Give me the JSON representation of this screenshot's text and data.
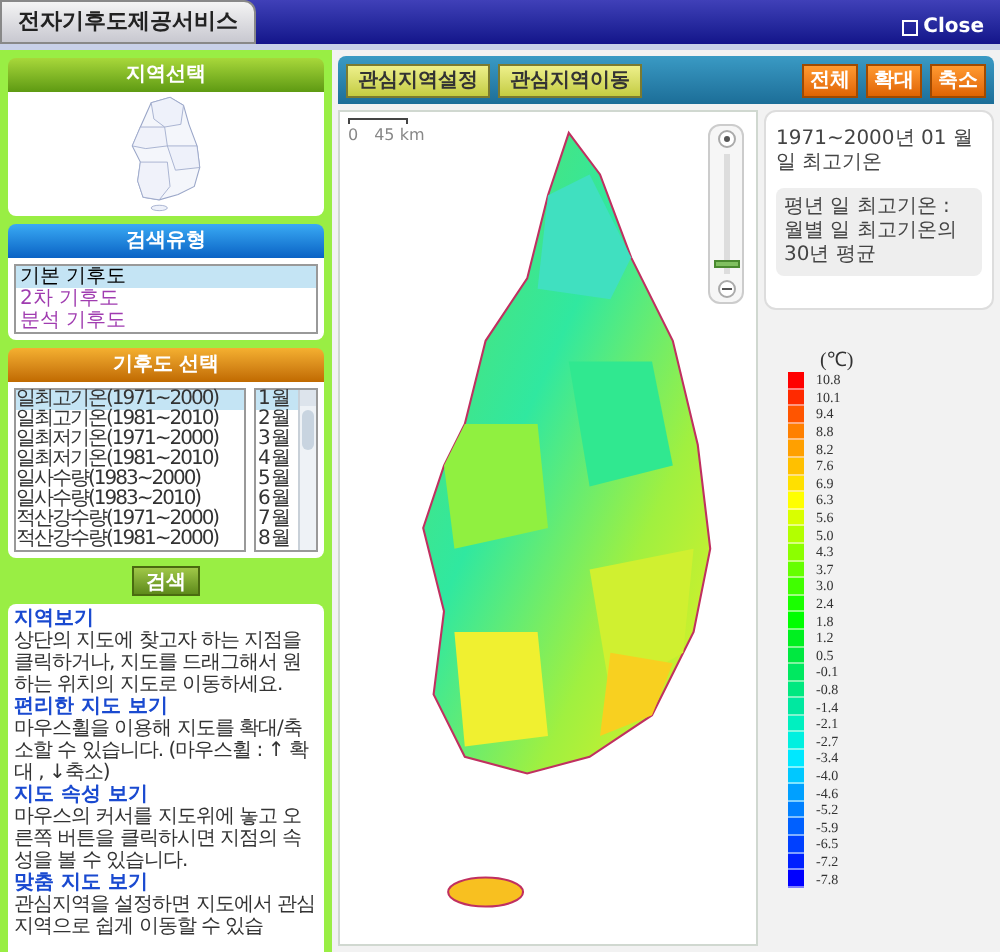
{
  "window": {
    "title": "전자기후도제공서비스",
    "close": "Close"
  },
  "region_select": {
    "title": "지역선택"
  },
  "search_type": {
    "title": "검색유형",
    "items": [
      {
        "label": "기본 기후도",
        "selected": true
      },
      {
        "label": "2차 기후도",
        "selected": false
      },
      {
        "label": "분석 기후도",
        "selected": false
      }
    ]
  },
  "map_select": {
    "title": "기후도 선택",
    "maps": [
      {
        "label": "일최고기온(1971~2000)",
        "selected": true
      },
      {
        "label": "일최고기온(1981~2010)",
        "selected": false
      },
      {
        "label": "일최저기온(1971~2000)",
        "selected": false
      },
      {
        "label": "일최저기온(1981~2010)",
        "selected": false
      },
      {
        "label": "일사수량(1983~2000)",
        "selected": false
      },
      {
        "label": "일사수량(1983~2010)",
        "selected": false
      },
      {
        "label": "적산강수량(1971~2000)",
        "selected": false
      },
      {
        "label": "적산강수량(1981~2000)",
        "selected": false
      }
    ],
    "months": [
      {
        "label": "1월",
        "selected": true
      },
      {
        "label": "2월",
        "selected": false
      },
      {
        "label": "3월",
        "selected": false
      },
      {
        "label": "4월",
        "selected": false
      },
      {
        "label": "5월",
        "selected": false
      },
      {
        "label": "6월",
        "selected": false
      },
      {
        "label": "7월",
        "selected": false
      },
      {
        "label": "8월",
        "selected": false
      }
    ],
    "search_button": "검색"
  },
  "help": [
    {
      "heading": "지역보기",
      "text": "상단의 지도에 찾고자 하는 지점을 클릭하거나, 지도를 드래그해서 원하는 위치의 지도로 이동하세요."
    },
    {
      "heading": "편리한 지도 보기",
      "text": "마우스휠을 이용해 지도를 확대/축소할 수 있습니다. (마우스휠 : ↑ 확대 , ↓축소)"
    },
    {
      "heading": "지도 속성 보기",
      "text": "마우스의 커서를 지도위에 놓고 오른쪽 버튼을 클릭하시면 지점의 속성을 볼 수 있습니다."
    },
    {
      "heading": "맞춤 지도 보기",
      "text": "관심지역을 설정하면 지도에서 관심 지역으로 쉽게 이동할 수 있습"
    }
  ],
  "toolbar": {
    "left_buttons": [
      "관심지역설정",
      "관심지역이동"
    ],
    "right_buttons": [
      "전체",
      "확대",
      "축소"
    ]
  },
  "map": {
    "scale": {
      "start": "0",
      "end": "45 km"
    },
    "zoom": {
      "level": 0.05
    }
  },
  "info": {
    "title": "1971~2000년 01 월 일 최고기온",
    "note": "평년 일 최고기온 : 월별 일 최고기온의 30년 평균"
  },
  "legend": {
    "unit": "(℃)",
    "items": [
      {
        "label": "10.8",
        "color": "#ff0000"
      },
      {
        "label": "10.1",
        "color": "#ff2a00"
      },
      {
        "label": "9.4",
        "color": "#ff5500"
      },
      {
        "label": "8.8",
        "color": "#ff8000"
      },
      {
        "label": "8.2",
        "color": "#ffa000"
      },
      {
        "label": "7.6",
        "color": "#ffc000"
      },
      {
        "label": "6.9",
        "color": "#ffe000"
      },
      {
        "label": "6.3",
        "color": "#ffff00"
      },
      {
        "label": "5.6",
        "color": "#d9ff00"
      },
      {
        "label": "5.0",
        "color": "#b3ff00"
      },
      {
        "label": "4.3",
        "color": "#8cff00"
      },
      {
        "label": "3.7",
        "color": "#66ff00"
      },
      {
        "label": "3.0",
        "color": "#40ff00"
      },
      {
        "label": "2.4",
        "color": "#1aff00"
      },
      {
        "label": "1.8",
        "color": "#00ff00"
      },
      {
        "label": "1.2",
        "color": "#00f020"
      },
      {
        "label": "0.5",
        "color": "#00e840"
      },
      {
        "label": "-0.1",
        "color": "#00e860"
      },
      {
        "label": "-0.8",
        "color": "#00e880"
      },
      {
        "label": "-1.4",
        "color": "#00e8a0"
      },
      {
        "label": "-2.1",
        "color": "#00f0c0"
      },
      {
        "label": "-2.7",
        "color": "#00f0e0"
      },
      {
        "label": "-3.4",
        "color": "#00e8ff"
      },
      {
        "label": "-4.0",
        "color": "#00c8ff"
      },
      {
        "label": "-4.6",
        "color": "#00a0ff"
      },
      {
        "label": "-5.2",
        "color": "#0080ff"
      },
      {
        "label": "-5.9",
        "color": "#0060ff"
      },
      {
        "label": "-6.5",
        "color": "#0040ff"
      },
      {
        "label": "-7.2",
        "color": "#0020ff"
      },
      {
        "label": "-7.8",
        "color": "#0000ff"
      }
    ]
  }
}
